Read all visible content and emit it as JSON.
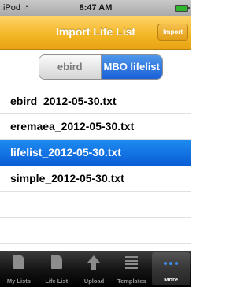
{
  "status": {
    "carrier": "iPod",
    "time": "8:47 AM"
  },
  "nav": {
    "title": "Import Life List",
    "import_label": "Import"
  },
  "segment": {
    "options": [
      "ebird",
      "MBO lifelist"
    ],
    "selected": "MBO lifelist"
  },
  "files": [
    {
      "name": "ebird_2012-05-30.txt",
      "selected": false
    },
    {
      "name": "eremaea_2012-05-30.txt",
      "selected": false
    },
    {
      "name": "lifelist_2012-05-30.txt",
      "selected": true
    },
    {
      "name": "simple_2012-05-30.txt",
      "selected": false
    }
  ],
  "tabs": [
    {
      "label": "My Lists",
      "icon": "document-stack-icon",
      "active": false
    },
    {
      "label": "Life List",
      "icon": "document-icon",
      "active": false
    },
    {
      "label": "Upload",
      "icon": "upload-arrow-icon",
      "active": false
    },
    {
      "label": "Templates",
      "icon": "list-lines-icon",
      "active": false
    },
    {
      "label": "More",
      "icon": "more-dots-icon",
      "active": true
    }
  ],
  "colors": {
    "nav": "#f2b524",
    "selection": "#0a5fd7",
    "segment_selected": "#1a60d8"
  }
}
